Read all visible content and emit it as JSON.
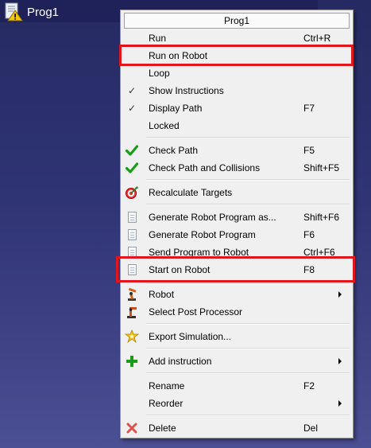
{
  "tree": {
    "item_label": "Prog1",
    "icon": "program-warning-icon"
  },
  "menu": {
    "title": "Prog1",
    "items": [
      {
        "label": "Run",
        "shortcut": "Ctrl+R",
        "icon": ""
      },
      {
        "label": "Run on Robot",
        "shortcut": "",
        "icon": ""
      },
      {
        "label": "Loop",
        "shortcut": "",
        "icon": ""
      },
      {
        "label": "Show Instructions",
        "shortcut": "",
        "icon": "checkmark"
      },
      {
        "label": "Display Path",
        "shortcut": "F7",
        "icon": "checkmark"
      },
      {
        "label": "Locked",
        "shortcut": "",
        "icon": ""
      },
      {
        "label": "Check Path",
        "shortcut": "F5",
        "icon": "green-check-icon"
      },
      {
        "label": "Check Path and Collisions",
        "shortcut": "Shift+F5",
        "icon": "green-check-icon"
      },
      {
        "label": "Recalculate Targets",
        "shortcut": "",
        "icon": "target-icon"
      },
      {
        "label": "Generate Robot Program as...",
        "shortcut": "Shift+F6",
        "icon": "document-icon"
      },
      {
        "label": "Generate Robot Program",
        "shortcut": "F6",
        "icon": "document-icon"
      },
      {
        "label": "Send Program to Robot",
        "shortcut": "Ctrl+F6",
        "icon": "document-icon"
      },
      {
        "label": "Start on Robot",
        "shortcut": "F8",
        "icon": "document-icon"
      },
      {
        "label": "Robot",
        "shortcut": "",
        "icon": "robot-icon",
        "submenu": true
      },
      {
        "label": "Select Post Processor",
        "shortcut": "",
        "icon": "robot-arm-icon"
      },
      {
        "label": "Export Simulation...",
        "shortcut": "",
        "icon": "export-icon"
      },
      {
        "label": "Add instruction",
        "shortcut": "",
        "icon": "plus-icon",
        "submenu": true
      },
      {
        "label": "Rename",
        "shortcut": "F2",
        "icon": ""
      },
      {
        "label": "Reorder",
        "shortcut": "",
        "icon": "",
        "submenu": true
      },
      {
        "label": "Delete",
        "shortcut": "Del",
        "icon": "delete-icon"
      }
    ]
  },
  "colors": {
    "highlight_box": "#e0161f",
    "menu_background": "#f0f0f0",
    "check_green": "#1a9c1a",
    "delete_red": "#d9534f"
  }
}
